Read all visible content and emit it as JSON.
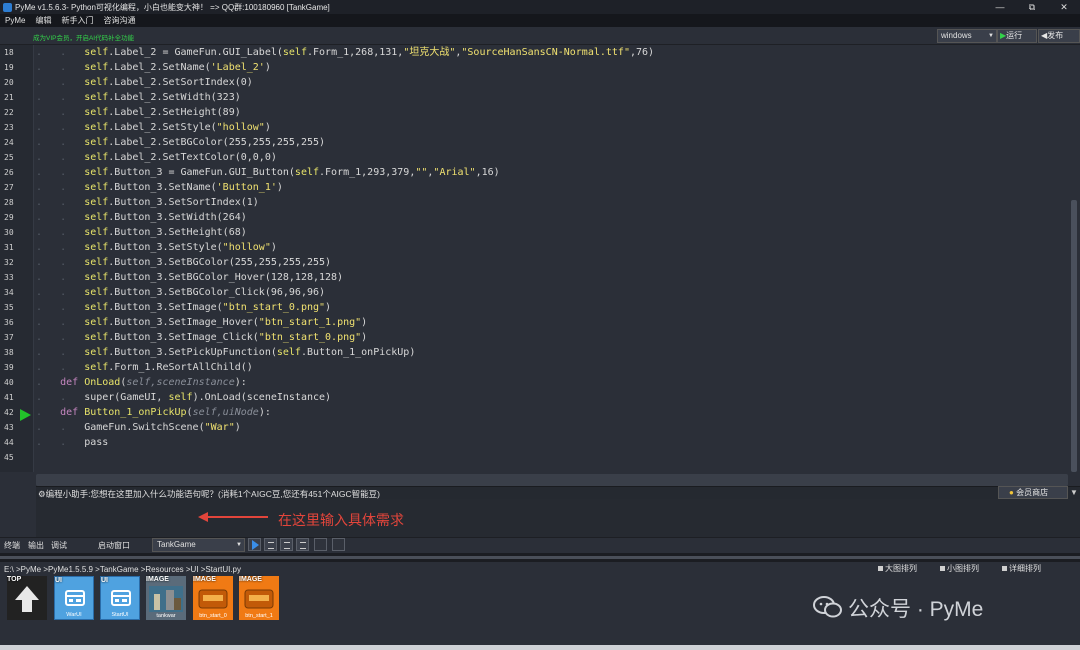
{
  "window": {
    "title": "PyMe v1.5.6.3- Python可视化编程，小白也能变大神！ => QQ群:100180960   [TankGame]",
    "controls": [
      "—",
      "⧉",
      "✕"
    ]
  },
  "menu": [
    "PyMe",
    "编辑",
    "新手入门",
    "咨询沟通"
  ],
  "vip_text": "成为VIP会员，开启AI代码补全功能",
  "toolbar": {
    "platform": "windows",
    "run_label": "运行",
    "publish_label": "发布"
  },
  "editor": {
    "current_line": 42,
    "line_numbers": [
      "18",
      "19",
      "20",
      "21",
      "22",
      "23",
      "24",
      "25",
      "26",
      "27",
      "28",
      "29",
      "30",
      "31",
      "32",
      "33",
      "34",
      "35",
      "36",
      "37",
      "38",
      "39",
      "40",
      "41",
      "42",
      "43",
      "44",
      "45"
    ],
    "lines": [
      {
        "indent": 2,
        "text": "self.Label_2 = GameFun.GUI_Label(self.Form_1,268,131,\"坦克大战\",\"SourceHanSansCN-Normal.ttf\",76)"
      },
      {
        "indent": 2,
        "text": "self.Label_2.SetName('Label_2')"
      },
      {
        "indent": 2,
        "text": "self.Label_2.SetSortIndex(0)"
      },
      {
        "indent": 2,
        "text": "self.Label_2.SetWidth(323)"
      },
      {
        "indent": 2,
        "text": "self.Label_2.SetHeight(89)"
      },
      {
        "indent": 2,
        "text": "self.Label_2.SetStyle(\"hollow\")"
      },
      {
        "indent": 2,
        "text": "self.Label_2.SetBGColor(255,255,255,255)"
      },
      {
        "indent": 2,
        "text": "self.Label_2.SetTextColor(0,0,0)"
      },
      {
        "indent": 2,
        "text": "self.Button_3 = GameFun.GUI_Button(self.Form_1,293,379,\"\",\"Arial\",16)"
      },
      {
        "indent": 2,
        "text": "self.Button_3.SetName('Button_1')"
      },
      {
        "indent": 2,
        "text": "self.Button_3.SetSortIndex(1)"
      },
      {
        "indent": 2,
        "text": "self.Button_3.SetWidth(264)"
      },
      {
        "indent": 2,
        "text": "self.Button_3.SetHeight(68)"
      },
      {
        "indent": 2,
        "text": "self.Button_3.SetStyle(\"hollow\")"
      },
      {
        "indent": 2,
        "text": "self.Button_3.SetBGColor(255,255,255,255)"
      },
      {
        "indent": 2,
        "text": "self.Button_3.SetBGColor_Hover(128,128,128)"
      },
      {
        "indent": 2,
        "text": "self.Button_3.SetBGColor_Click(96,96,96)"
      },
      {
        "indent": 2,
        "text": "self.Button_3.SetImage(\"btn_start_0.png\")"
      },
      {
        "indent": 2,
        "text": "self.Button_3.SetImage_Hover(\"btn_start_1.png\")"
      },
      {
        "indent": 2,
        "text": "self.Button_3.SetImage_Click(\"btn_start_0.png\")"
      },
      {
        "indent": 2,
        "text": "self.Button_3.SetPickUpFunction(self.Button_1_onPickUp)"
      },
      {
        "indent": 2,
        "text": "self.Form_1.ReSortAllChild()"
      },
      {
        "indent": 1,
        "text": "def OnLoad(self,sceneInstance):"
      },
      {
        "indent": 2,
        "text": "super(GameUI, self).OnLoad(sceneInstance)"
      },
      {
        "indent": 1,
        "text": "def Button_1_onPickUp(self,uiNode):"
      },
      {
        "indent": 2,
        "text": "GameFun.SwitchScene(\"War\")"
      },
      {
        "indent": 2,
        "text": "pass"
      },
      {
        "indent": 0,
        "text": ""
      }
    ]
  },
  "assistant": {
    "prompt": "编程小助手:您想在这里加入什么功能语句呢？(消耗1个AIGC豆,您还有451个AIGC智能豆)",
    "member_label": "会员商店"
  },
  "annotation": "在这里输入具体需求",
  "bottom_tabs": [
    "终端",
    "输出",
    "调试",
    "启动窗口"
  ],
  "scene_select": "TankGame",
  "file_browser": {
    "path": "E:\\ >PyMe >PyMe1.5.5.9 >TankGame >Resources >UI >StartUI.py",
    "view_options": [
      "大图排列",
      "小图排列",
      "详细排列"
    ],
    "items": [
      {
        "tag": "TOP",
        "caption": ""
      },
      {
        "tag": "UI",
        "caption": "WarUI"
      },
      {
        "tag": "UI",
        "caption": "StartUI"
      },
      {
        "tag": "IMAGE",
        "caption": "tankwar"
      },
      {
        "tag": "IMAGE",
        "caption": "btn_start_0"
      },
      {
        "tag": "IMAGE",
        "caption": "btn_start_1"
      }
    ]
  },
  "watermark": "公众号 · PyMe"
}
